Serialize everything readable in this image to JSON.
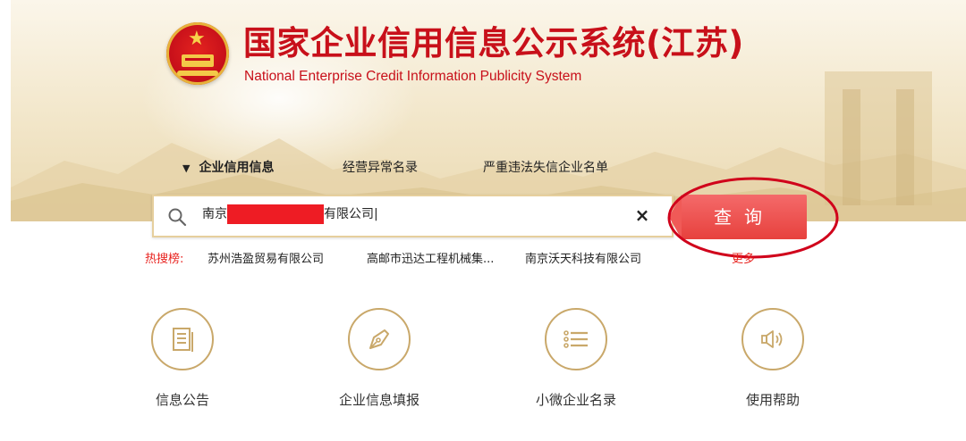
{
  "header": {
    "title_cn": "国家企业信用信息公示系统(江苏)",
    "title_en": "National Enterprise Credit Information Publicity System"
  },
  "tabs": [
    {
      "label": "企业信用信息",
      "active": true
    },
    {
      "label": "经营异常名录",
      "active": false
    },
    {
      "label": "严重违法失信企业名单",
      "active": false
    }
  ],
  "search": {
    "value_prefix": "南京",
    "value_suffix": "有限公司|",
    "button_label": "查询",
    "clear_icon": "×"
  },
  "hot_search": {
    "label": "热搜榜:",
    "items": [
      "苏州浩盈贸易有限公司",
      "高邮市迅达工程机械集...",
      "南京沃天科技有限公司"
    ],
    "more_label": "更多"
  },
  "features": [
    {
      "label": "信息公告",
      "icon": "document-icon"
    },
    {
      "label": "企业信息填报",
      "icon": "pen-icon"
    },
    {
      "label": "小微企业名录",
      "icon": "list-icon"
    },
    {
      "label": "使用帮助",
      "icon": "speaker-icon"
    }
  ],
  "colors": {
    "brand_red": "#c8101a",
    "button_red": "#e7413d",
    "accent_gold": "#c9a86a",
    "annotation_red": "#d0021b"
  }
}
